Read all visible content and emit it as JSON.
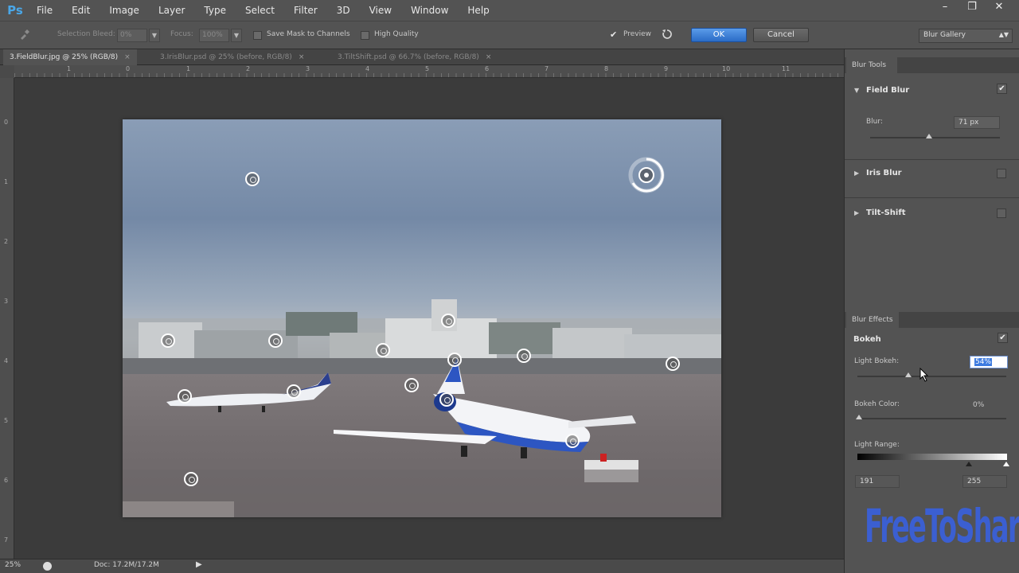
{
  "app": {
    "logo": "Ps"
  },
  "menu": [
    "File",
    "Edit",
    "Image",
    "Layer",
    "Type",
    "Select",
    "Filter",
    "3D",
    "View",
    "Window",
    "Help"
  ],
  "window_controls": [
    "–",
    "❐",
    "✕"
  ],
  "options": {
    "selection_bleed_label": "Selection Bleed:",
    "selection_bleed_value": "0%",
    "focus_label": "Focus:",
    "focus_value": "100%",
    "save_mask_label": "Save Mask to Channels",
    "high_quality_label": "High Quality",
    "preview_label": "Preview",
    "ok_label": "OK",
    "cancel_label": "Cancel",
    "gallery_value": "Blur Gallery"
  },
  "tabs": [
    {
      "label": "3.FieldBlur.jpg @ 25% (RGB/8)",
      "active": true
    },
    {
      "label": "3.IrisBlur.psd @ 25% (before, RGB/8)",
      "active": false
    },
    {
      "label": "3.TiltShift.psd @ 66.7% (before, RGB/8)",
      "active": false
    }
  ],
  "ruler_top_ticks": [
    "1",
    "0",
    "1",
    "2",
    "3",
    "4",
    "5",
    "6",
    "7",
    "8",
    "9",
    "10",
    "11"
  ],
  "ruler_left_ticks": [
    "0",
    "1",
    "2",
    "3",
    "4",
    "5",
    "6",
    "7"
  ],
  "status": {
    "zoom": "25%",
    "doc": "Doc: 17.2M/17.2M"
  },
  "panel": {
    "blur_tools_tab": "Blur Tools",
    "field_blur_title": "Field Blur",
    "blur_label": "Blur:",
    "blur_value": "71 px",
    "iris_blur_title": "Iris Blur",
    "tilt_shift_title": "Tilt-Shift",
    "blur_effects_tab": "Blur Effects",
    "bokeh_title": "Bokeh",
    "light_bokeh_label": "Light Bokeh:",
    "light_bokeh_value": "54%",
    "bokeh_color_label": "Bokeh Color:",
    "bokeh_color_value": "0%",
    "light_range_label": "Light Range:",
    "light_range_min": "191",
    "light_range_max": "255"
  },
  "watermark": "FreeToShare",
  "colors": {
    "accent": "#2a6cc6",
    "panel": "#535353",
    "watermark": "#3b5fd1"
  }
}
